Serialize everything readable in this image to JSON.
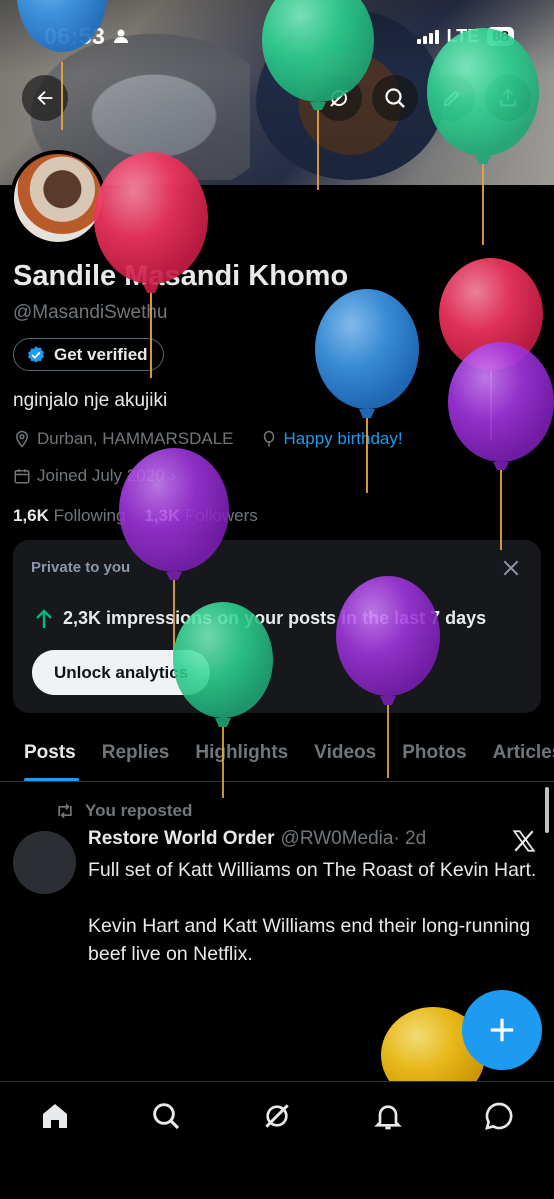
{
  "status_bar": {
    "time": "06:53",
    "network": "LTE",
    "battery": "88"
  },
  "profile": {
    "display_name": "Sandile Masandi Khomo",
    "handle": "@MasandiSwethu",
    "get_verified_label": "Get verified",
    "bio": "nginjalo nje akujiki",
    "location": "Durban, HAMMARSDALE",
    "birthday_label": "Happy birthday!",
    "joined": "Joined July 2020",
    "following_count": "1,6K",
    "following_label": "Following",
    "followers_count": "1,3K",
    "followers_label": "Followers"
  },
  "analytics_card": {
    "title": "Private to you",
    "impressions_count": "2,3K",
    "impressions_text": "impressions on your posts in the last 7 days",
    "button_label": "Unlock analytics"
  },
  "tabs": [
    "Posts",
    "Replies",
    "Highlights",
    "Videos",
    "Photos",
    "Articles"
  ],
  "active_tab": "Posts",
  "post": {
    "repost_label": "You reposted",
    "author_name": "Restore World Order",
    "author_handle": "@RW0Media",
    "time": "· 2d",
    "text": "Full set of Katt Williams on The Roast of Kevin Hart.\n\nKevin Hart and Katt Williams end their long-running beef live on Netflix."
  },
  "colors": {
    "accent": "#1d9bf0",
    "background": "#000000",
    "card": "#16181c",
    "muted": "#71767b",
    "impressions_arrow": "#00ba7c"
  },
  "icons": [
    "back-arrow-icon",
    "grok-icon",
    "search-icon",
    "edit-icon",
    "share-icon",
    "verified-badge-icon",
    "location-icon",
    "birthday-balloon-icon",
    "calendar-icon",
    "close-icon",
    "arrow-up-icon",
    "repost-icon",
    "x-logo-icon",
    "plus-icon",
    "home-icon",
    "explore-icon",
    "notifications-icon",
    "messages-icon"
  ]
}
